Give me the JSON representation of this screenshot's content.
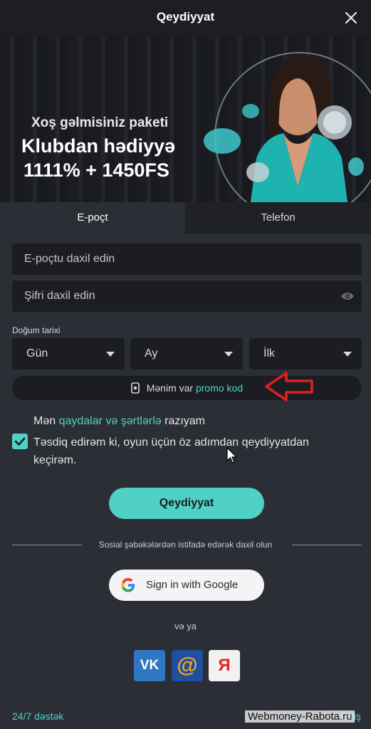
{
  "header": {
    "title": "Qeydiyyat",
    "close_icon": "close-icon"
  },
  "banner": {
    "line1": "Xoş gəlmisiniz paketi",
    "line2": "Klubdan hədiyyə",
    "line3": "1111% + 1450FS"
  },
  "tabs": [
    {
      "label": "E-poçt",
      "active": true
    },
    {
      "label": "Telefon",
      "active": false
    }
  ],
  "form": {
    "email_placeholder": "E-poçtu daxil edin",
    "password_placeholder": "Şifri daxil edin",
    "dob_label": "Doğum tarixi",
    "day": "Gün",
    "month": "Ay",
    "year": "İlk",
    "promo_prefix": "Mənim var",
    "promo_link": "promo kod",
    "terms_prefix": "Mən",
    "terms_link": "qaydalar və şərtlərlə",
    "terms_suffix": "razıyam",
    "confirm_text": "Təsdiq edirəm ki, oyun üçün öz adımdan qeydiyyatdan keçirəm.",
    "confirm_checked": true,
    "submit_label": "Qeydiyyat"
  },
  "social": {
    "divider_text": "Sosial şəbəkələrdən istifadə edərək daxil olun",
    "google_label": "Sign in with Google",
    "or_text": "və ya",
    "vk_label": "VK",
    "mail_label": "@",
    "ya_label": "Я"
  },
  "footer": {
    "support": "24/7 dəstək",
    "login": "Giriş",
    "watermark": "Webmoney-Rabota.ru"
  },
  "colors": {
    "accent": "#4fd1c5",
    "background": "#2b2e35",
    "input": "#1b1d22",
    "annotation_arrow": "#e0201c"
  }
}
